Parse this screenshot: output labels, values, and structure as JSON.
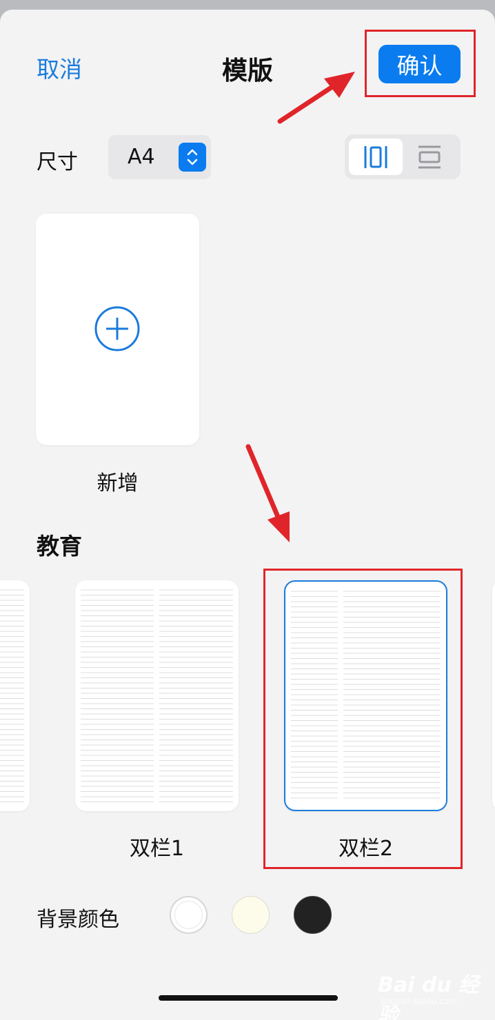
{
  "header": {
    "cancel_label": "取消",
    "title": "模版",
    "confirm_label": "确认"
  },
  "size": {
    "label": "尺寸",
    "value": "A4"
  },
  "orientation": {
    "selected": "portrait",
    "options": [
      "portrait-icon",
      "landscape-icon"
    ]
  },
  "new_template": {
    "label": "新增"
  },
  "education": {
    "section_title": "教育",
    "templates": [
      {
        "label": "双栏1",
        "selected": false
      },
      {
        "label": "双栏2",
        "selected": true
      }
    ]
  },
  "background": {
    "label": "背景颜色",
    "colors": [
      "#ffffff",
      "#fdfcea",
      "#222222"
    ]
  },
  "accent_color": "#0a7cf0",
  "annotation_color": "#e0252a",
  "watermark": {
    "text": "Bai du 经验",
    "sub": "jingyan.baidu.com"
  }
}
